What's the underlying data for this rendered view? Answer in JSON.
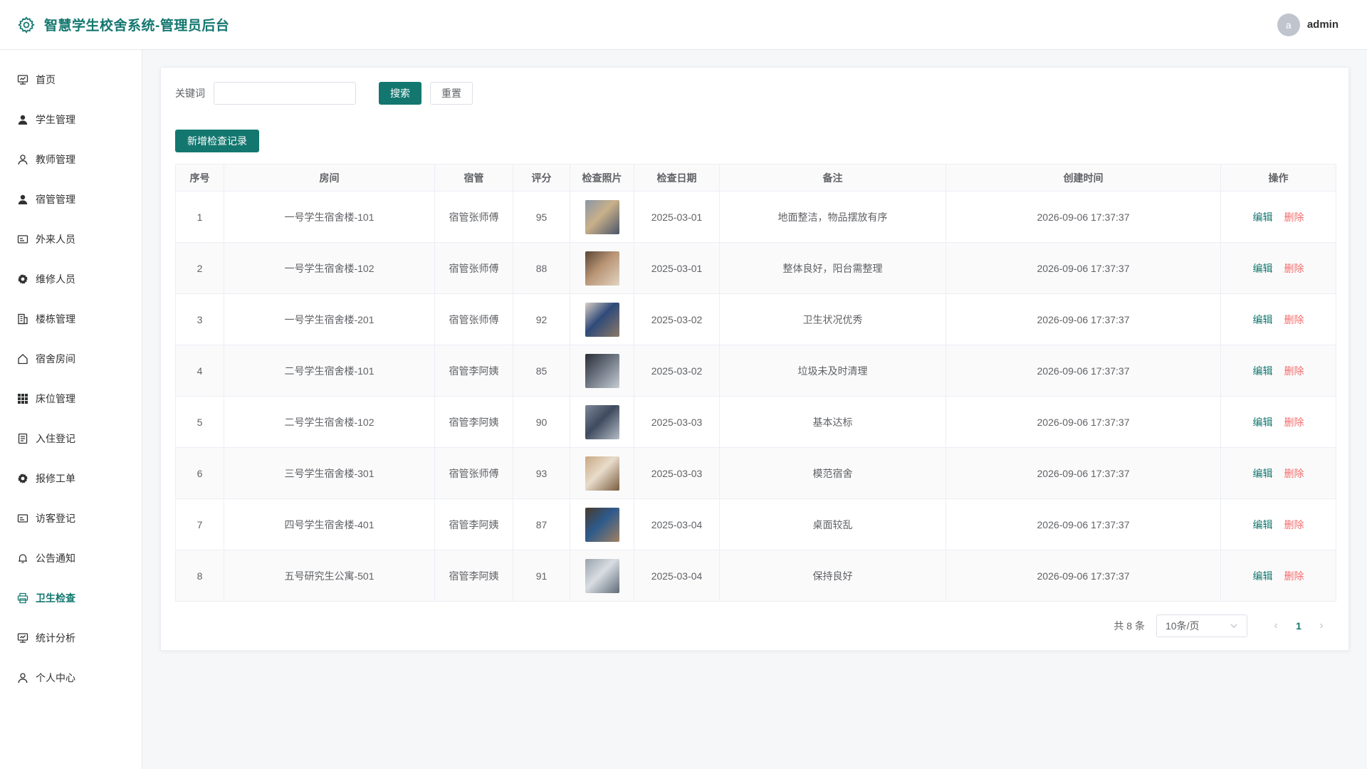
{
  "header": {
    "title": "智慧学生校舍系统-管理员后台",
    "avatar_letter": "a",
    "username": "admin",
    "accent": "#13776f"
  },
  "sidebar": {
    "items": [
      {
        "label": "首页",
        "icon": "monitor-icon",
        "active": false
      },
      {
        "label": "学生管理",
        "icon": "user-filled-icon",
        "active": false
      },
      {
        "label": "教师管理",
        "icon": "user-icon",
        "active": false
      },
      {
        "label": "宿管管理",
        "icon": "user-filled-icon",
        "active": false
      },
      {
        "label": "外来人员",
        "icon": "id-card-icon",
        "active": false
      },
      {
        "label": "维修人员",
        "icon": "gear-icon",
        "active": false
      },
      {
        "label": "楼栋管理",
        "icon": "building-icon",
        "active": false
      },
      {
        "label": "宿舍房间",
        "icon": "house-icon",
        "active": false
      },
      {
        "label": "床位管理",
        "icon": "grid-icon",
        "active": false
      },
      {
        "label": "入住登记",
        "icon": "document-icon",
        "active": false
      },
      {
        "label": "报修工单",
        "icon": "gear-icon",
        "active": false
      },
      {
        "label": "访客登记",
        "icon": "id-card-icon",
        "active": false
      },
      {
        "label": "公告通知",
        "icon": "bell-icon",
        "active": false
      },
      {
        "label": "卫生检查",
        "icon": "printer-icon",
        "active": true
      },
      {
        "label": "统计分析",
        "icon": "monitor-icon",
        "active": false
      },
      {
        "label": "个人中心",
        "icon": "user-icon",
        "active": false
      }
    ]
  },
  "search": {
    "label": "关键词",
    "value": "",
    "placeholder": "",
    "search_button": "搜索",
    "reset_button": "重置"
  },
  "toolbar": {
    "add_button": "新增检查记录"
  },
  "table": {
    "columns": [
      "序号",
      "房间",
      "宿管",
      "评分",
      "检查照片",
      "检查日期",
      "备注",
      "创建时间",
      "操作"
    ],
    "edit_label": "编辑",
    "delete_label": "删除",
    "rows": [
      {
        "no": "1",
        "room": "一号学生宿舍楼-101",
        "manager": "宿管张师傅",
        "score": "95",
        "photo_colors": [
          "#8a96a6",
          "#c9b08a",
          "#4a5568"
        ],
        "date": "2025-03-01",
        "remark": "地面整洁，物品摆放有序",
        "created": "2026-09-06 17:37:37"
      },
      {
        "no": "2",
        "room": "一号学生宿舍楼-102",
        "manager": "宿管张师傅",
        "score": "88",
        "photo_colors": [
          "#5b4636",
          "#b89474",
          "#e2d4c2"
        ],
        "date": "2025-03-01",
        "remark": "整体良好，阳台需整理",
        "created": "2026-09-06 17:37:37"
      },
      {
        "no": "3",
        "room": "一号学生宿舍楼-201",
        "manager": "宿管张师傅",
        "score": "92",
        "photo_colors": [
          "#d9cfc4",
          "#2f4a7a",
          "#8c7a66"
        ],
        "date": "2025-03-02",
        "remark": "卫生状况优秀",
        "created": "2026-09-06 17:37:37"
      },
      {
        "no": "4",
        "room": "二号学生宿舍楼-101",
        "manager": "宿管李阿姨",
        "score": "85",
        "photo_colors": [
          "#2b2f36",
          "#6b7380",
          "#c7ccd3"
        ],
        "date": "2025-03-02",
        "remark": "垃圾未及时清理",
        "created": "2026-09-06 17:37:37"
      },
      {
        "no": "5",
        "room": "二号学生宿舍楼-102",
        "manager": "宿管李阿姨",
        "score": "90",
        "photo_colors": [
          "#7d8898",
          "#3e4a5e",
          "#b5bcc6"
        ],
        "date": "2025-03-03",
        "remark": "基本达标",
        "created": "2026-09-06 17:37:37"
      },
      {
        "no": "6",
        "room": "三号学生宿舍楼-301",
        "manager": "宿管张师傅",
        "score": "93",
        "photo_colors": [
          "#c8a882",
          "#e8dccb",
          "#7a5c3e"
        ],
        "date": "2025-03-03",
        "remark": "模范宿舍",
        "created": "2026-09-06 17:37:37"
      },
      {
        "no": "7",
        "room": "四号学生宿舍楼-401",
        "manager": "宿管李阿姨",
        "score": "87",
        "photo_colors": [
          "#4a3a2c",
          "#2d5a8c",
          "#a08060"
        ],
        "date": "2025-03-04",
        "remark": "桌面较乱",
        "created": "2026-09-06 17:37:37"
      },
      {
        "no": "8",
        "room": "五号研究生公寓-501",
        "manager": "宿管李阿姨",
        "score": "91",
        "photo_colors": [
          "#9aa3ad",
          "#d8dde2",
          "#5f6b78"
        ],
        "date": "2025-03-04",
        "remark": "保持良好",
        "created": "2026-09-06 17:37:37"
      }
    ]
  },
  "pagination": {
    "total_text": "共 8 条",
    "page_size": "10条/页",
    "current_page": "1",
    "prev_icon": "chevron-left-icon",
    "next_icon": "chevron-right-icon"
  }
}
